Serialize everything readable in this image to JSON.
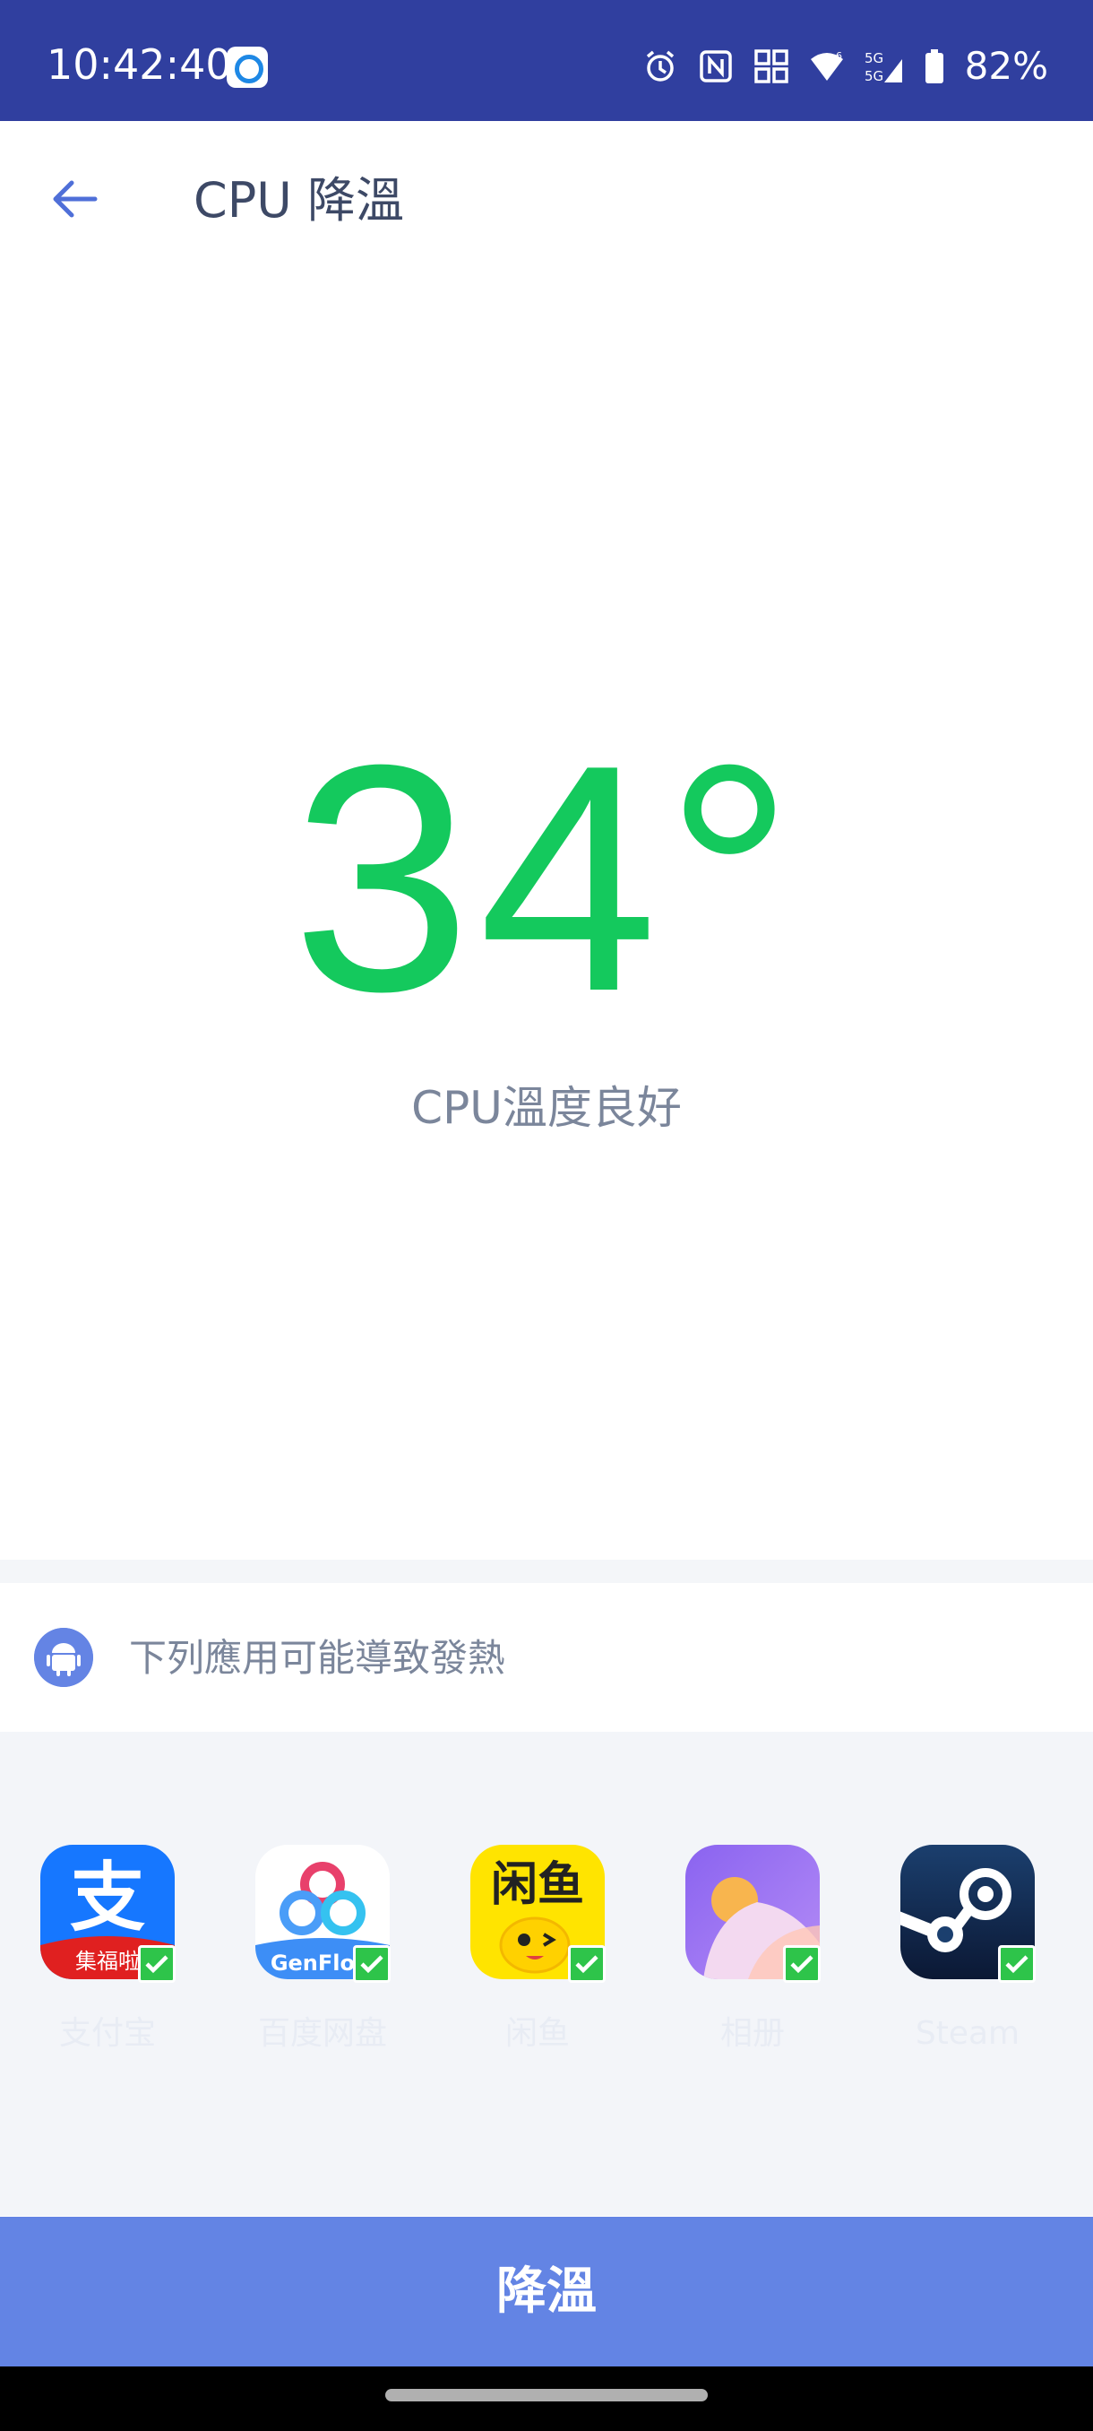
{
  "status_bar": {
    "time": "10:42:40",
    "battery": "82%",
    "icons": [
      "notification-app-icon",
      "alarm-icon",
      "nfc-icon",
      "qr-icon",
      "wifi-icon",
      "signal-5g-icon",
      "battery-icon"
    ]
  },
  "app_bar": {
    "back_icon": "arrow-left-icon",
    "title": "CPU 降溫"
  },
  "temperature": {
    "value": "34°",
    "status": "CPU溫度良好",
    "color": "#14c95d"
  },
  "apps_section": {
    "header": "下列應用可能導致發熱",
    "header_icon": "android-icon",
    "apps": [
      {
        "name": "支付宝",
        "badge_text": "集福啦",
        "checked": true
      },
      {
        "name": "百度网盘",
        "badge_text": "GenFlow",
        "checked": true
      },
      {
        "name": "闲鱼",
        "badge_text": "闲鱼",
        "checked": true
      },
      {
        "name": "相册",
        "checked": true
      },
      {
        "name": "Steam",
        "checked": true
      }
    ]
  },
  "action_button": {
    "label": "降溫",
    "color": "#6384e4"
  }
}
